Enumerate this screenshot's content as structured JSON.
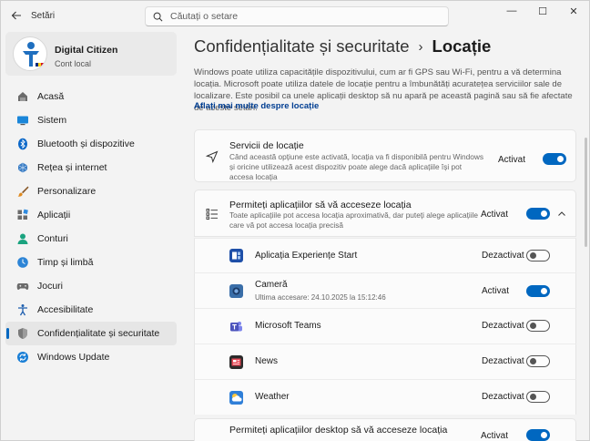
{
  "window": {
    "title": "Setări",
    "controls": {
      "minimize": "—",
      "maximize": "☐",
      "close": "✕"
    }
  },
  "search": {
    "placeholder": "Căutați o setare"
  },
  "profile": {
    "name": "Digital Citizen",
    "account": "Cont local"
  },
  "sidebar": {
    "items": [
      {
        "label": "Acasă",
        "icon": "home-icon"
      },
      {
        "label": "Sistem",
        "icon": "system-icon"
      },
      {
        "label": "Bluetooth și dispozitive",
        "icon": "bluetooth-icon"
      },
      {
        "label": "Rețea și internet",
        "icon": "network-icon"
      },
      {
        "label": "Personalizare",
        "icon": "brush-icon"
      },
      {
        "label": "Aplicații",
        "icon": "apps-icon"
      },
      {
        "label": "Conturi",
        "icon": "accounts-icon"
      },
      {
        "label": "Timp și limbă",
        "icon": "time-language-icon"
      },
      {
        "label": "Jocuri",
        "icon": "gaming-icon"
      },
      {
        "label": "Accesibilitate",
        "icon": "accessibility-icon"
      },
      {
        "label": "Confidențialitate și securitate",
        "icon": "shield-icon"
      },
      {
        "label": "Windows Update",
        "icon": "update-icon"
      }
    ],
    "active": "Confidențialitate și securitate"
  },
  "breadcrumb": {
    "parent": "Confidențialitate și securitate",
    "separator": "›",
    "current": "Locație"
  },
  "description": {
    "text": "Windows poate utiliza capacitățile dispozitivului, cum ar fi GPS sau Wi-Fi, pentru a vă determina locația. Microsoft poate utiliza datele de locație pentru a îmbunătăți acuratețea serviciilor sale de localizare. Este posibil ca unele aplicații desktop să nu apară pe această pagină sau să fie afectate de aceste setări.",
    "link": "Aflați mai multe despre locație"
  },
  "location_services": {
    "title": "Servicii de locație",
    "description": "Când această opțiune este activată, locația va fi disponibilă pentru Windows și oricine utilizează acest dispozitiv poate alege dacă aplicațiile își pot accesa locația",
    "state": "Activat",
    "on": true
  },
  "app_access": {
    "title": "Permiteți aplicațiilor să vă acceseze locația",
    "description": "Toate aplicațiile pot accesa locația aproximativă, dar puteți alege aplicațiile care vă pot accesa locația precisă",
    "state": "Activat",
    "on": true,
    "expand_icon": "chevron-up-icon"
  },
  "apps": [
    {
      "name": "Aplicația Experiențe Start",
      "sub": "",
      "state": "Dezactivat",
      "on": false,
      "icon_color": "#1e4fa8"
    },
    {
      "name": "Cameră",
      "sub": "Ultima accesare: 24.10.2025 la 15:12:46",
      "state": "Activat",
      "on": true,
      "icon_color": "#3a6ea8"
    },
    {
      "name": "Microsoft Teams",
      "sub": "",
      "state": "Dezactivat",
      "on": false,
      "icon_color": "#5b5fc7"
    },
    {
      "name": "News",
      "sub": "",
      "state": "Dezactivat",
      "on": false,
      "icon_color": "#d13438"
    },
    {
      "name": "Weather",
      "sub": "",
      "state": "Dezactivat",
      "on": false,
      "icon_color": "#2f7fd8"
    }
  ],
  "desktop_access": {
    "title": "Permiteți aplicațiilor desktop să vă acceseze locația",
    "state": "Activat",
    "on": true
  }
}
